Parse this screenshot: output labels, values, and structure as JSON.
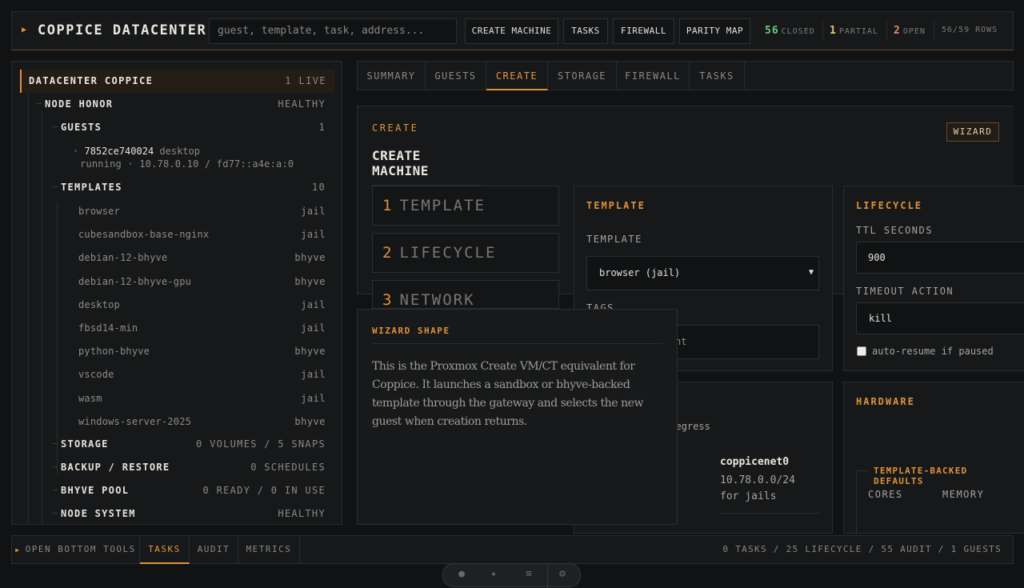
{
  "topbar": {
    "brand": "COPPICE DATACENTER",
    "search_placeholder": "guest, template, task, address...",
    "buttons": [
      "CREATE MACHINE",
      "TASKS",
      "FIREWALL",
      "PARITY MAP"
    ],
    "stats": [
      {
        "value": "56",
        "label": "CLOSED",
        "color": "#6ec97a"
      },
      {
        "value": "1",
        "label": "PARTIAL",
        "color": "#e6c66a"
      },
      {
        "value": "2",
        "label": "OPEN",
        "color": "#e8866a"
      }
    ],
    "rows": "56/59 ROWS"
  },
  "sidebar": {
    "datacenter": {
      "label": "DATACENTER COPPICE",
      "value": "1 LIVE"
    },
    "node": {
      "label": "NODE HONOR",
      "value": "HEALTHY"
    },
    "guests": {
      "label": "GUESTS",
      "value": "1"
    },
    "guest": {
      "id": "7852ce740024",
      "name": "desktop",
      "detail": "running · 10.78.0.10 / fd77::a4e:a:0"
    },
    "templates": {
      "label": "TEMPLATES",
      "value": "10"
    },
    "template_items": [
      {
        "name": "browser",
        "kind": "jail"
      },
      {
        "name": "cubesandbox-base-nginx",
        "kind": "jail"
      },
      {
        "name": "debian-12-bhyve",
        "kind": "bhyve"
      },
      {
        "name": "debian-12-bhyve-gpu",
        "kind": "bhyve"
      },
      {
        "name": "desktop",
        "kind": "jail"
      },
      {
        "name": "fbsd14-min",
        "kind": "jail"
      },
      {
        "name": "python-bhyve",
        "kind": "bhyve"
      },
      {
        "name": "vscode",
        "kind": "jail"
      },
      {
        "name": "wasm",
        "kind": "jail"
      },
      {
        "name": "windows-server-2025",
        "kind": "bhyve"
      }
    ],
    "sections": [
      {
        "label": "STORAGE",
        "value": "0 VOLUMES / 5 SNAPS"
      },
      {
        "label": "BACKUP / RESTORE",
        "value": "0 SCHEDULES"
      },
      {
        "label": "BHYVE POOL",
        "value": "0 READY / 0 IN USE"
      },
      {
        "label": "NODE SYSTEM",
        "value": "HEALTHY"
      }
    ]
  },
  "tabs": [
    "SUMMARY",
    "GUESTS",
    "CREATE",
    "STORAGE",
    "FIREWALL",
    "TASKS"
  ],
  "create": {
    "kicker": "CREATE",
    "title": "CREATE MACHINE",
    "wizard": "WIZARD",
    "steps": [
      {
        "num": "1",
        "label": "TEMPLATE"
      },
      {
        "num": "2",
        "label": "LIFECYCLE"
      },
      {
        "num": "3",
        "label": "NETWORK"
      }
    ],
    "template_card": {
      "title": "TEMPLATE",
      "field_label": "TEMPLATE",
      "selected": "browser (jail)",
      "tags_label": "TAGS",
      "tags_partial": "nt"
    },
    "lifecycle_card": {
      "title": "LIFECYCLE",
      "ttl_label": "TTL SECONDS",
      "ttl_value": "900",
      "timeout_label": "TIMEOUT ACTION",
      "timeout_value": "kill",
      "autoresume": "auto-resume if paused"
    },
    "network_card": {
      "egress_partial": "t egress",
      "net_name": "coppicenet0",
      "net_cidr": "10.78.0.0/24",
      "net_note": "for jails"
    },
    "hardware_card": {
      "title": "HARDWARE",
      "group": "TEMPLATE-BACKED DEFAULTS",
      "cores": "CORES",
      "memory": "MEMORY"
    }
  },
  "note": {
    "title": "WIZARD SHAPE",
    "body": "This is the Proxmox Create VM/CT equivalent for Coppice. It launches a sandbox or bhyve-backed template through the gateway and selects the new guest when creation returns."
  },
  "bottombar": {
    "open_tools": "OPEN BOTTOM TOOLS",
    "tabs": [
      "TASKS",
      "AUDIT",
      "METRICS"
    ],
    "stats": "0 TASKS / 25 LIFECYCLE / 55 AUDIT / 1 GUESTS"
  },
  "colors": {
    "accent": "#e0923a",
    "bg": "#101214",
    "panel": "#16181a"
  }
}
